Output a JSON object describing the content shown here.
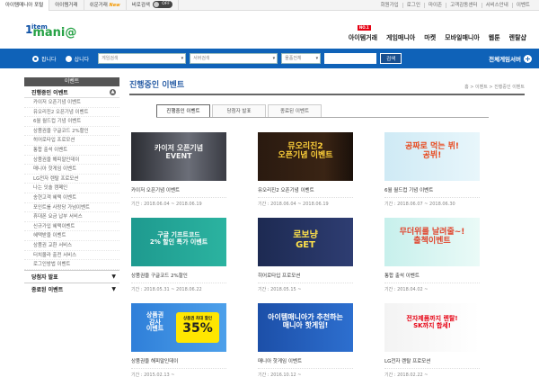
{
  "topbar": {
    "tabs": [
      "아이템매니아 포털",
      "아이템거래",
      "쉬운거래",
      "비로검색"
    ],
    "new_badge": "New",
    "toggle_label": "OFF",
    "links": [
      "회원가입",
      "로그인",
      "마이존",
      "고객감동센터",
      "서비스안내",
      "이벤트"
    ]
  },
  "logo": {
    "one": "1",
    "item": "item",
    "mania": "mani@"
  },
  "nav": {
    "no1": "NO.1",
    "items": [
      "아이템거래",
      "게임매니아",
      "마켓",
      "모바일매니아",
      "웹툰",
      "렌탈샵"
    ]
  },
  "search": {
    "radio_sell": "팝니다",
    "radio_buy": "삽니다",
    "game_select": "게임검색",
    "server_select": "서버검색",
    "item_select": "물품전체",
    "button": "검색",
    "all_games": "전체게임서버"
  },
  "sidebar": {
    "title": "이벤트",
    "section1": "진행중인 이벤트",
    "items": [
      "카이저 오픈기념 이벤트",
      "유오리진2 오픈기념 이벤트",
      "6월 월드컵 기념 이벤트",
      "상품권을 구글코드 2%할인",
      "히어로타입 프로모션",
      "통합 출석 이벤트",
      "상품권을 해피말인데이",
      "매니아 핫게임 이벤트",
      "LG전자 렌탈 프로모션",
      "나는 잇솔 캠페인",
      "송현고객 혜택 이벤트",
      "포인트를 사랑당 가넘이벤트",
      "휴대폰 요금 납부 서비스",
      "신규가입 혜택이벤트",
      "혜택받을 이벤트",
      "상품권 교환 서비스",
      "터치올라 출전 서비스",
      "로그인방법 이벤트"
    ],
    "section2": "당첨자 발표",
    "section3": "종료된 이벤트"
  },
  "content": {
    "title": "진행중인 이벤트",
    "breadcrumb": "홈 > 이벤트 > 진행중인 이벤트",
    "tabs": [
      "진행중인 이벤트",
      "당첨자 발표",
      "종료된 이벤트"
    ]
  },
  "cards": [
    {
      "name": "카이저 오픈기념 이벤트",
      "date": "기간 : 2018.06.04 ~ 2018.06.19",
      "banner": "카이저 오픈기념\nEVENT"
    },
    {
      "name": "유오리진2 오픈기념 이벤트",
      "date": "기간 : 2018.06.04 ~ 2018.06.19",
      "banner": "뮤오리진2\n오픈기념 이벤트"
    },
    {
      "name": "6월 월드컵 기념 이벤트",
      "date": "기간 : 2018.06.07 ~ 2018.06.30",
      "banner": "공짜로 먹는 뷔!\n공뷔!"
    },
    {
      "name": "상품권을 구글코드 2%할인",
      "date": "기간 : 2018.05.31 ~ 2018.06.22",
      "banner": "구글 기프트코드\n2% 할인 특가 이벤트"
    },
    {
      "name": "히어로타입 프로모션",
      "date": "기간 : 2018.05.15 ~",
      "banner": "로보냥\nGET"
    },
    {
      "name": "통합 출석 이벤트",
      "date": "기간 : 2018.04.02 ~",
      "banner": "무더위를 날려줄~!\n출첵이벤트"
    },
    {
      "name": "상품권을 해피말인데이",
      "date": "기간 : 2015.02.13 ~",
      "banner": "상품권\n감사\n이벤트"
    },
    {
      "name": "매니아 핫게임 이벤트",
      "date": "기간 : 2016.10.12 ~",
      "banner": "아이템매니아가 추천하는\n매니아 핫게임!"
    },
    {
      "name": "LG전자 렌탈 프로모션",
      "date": "기간 : 2018.02.22 ~",
      "banner": "전자제품까지 렌탈!\nSK까지 합세!"
    }
  ],
  "extra": {
    "pct": "35%",
    "pct_label": "상품권 최대 할인"
  },
  "colors": {
    "accent_blue": "#0f62b8",
    "title_blue": "#2b5fa6",
    "red": "#e60012"
  }
}
